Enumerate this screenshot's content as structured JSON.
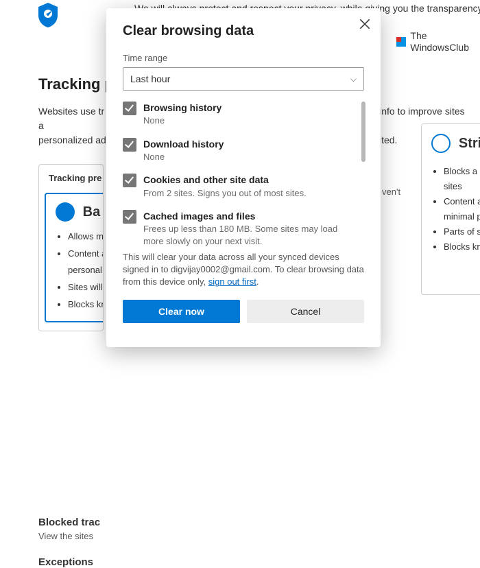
{
  "bg": {
    "top_text": "We will always protect and respect your privacy, while giving you the transparency",
    "brand_line1": "The",
    "brand_line2": "WindowsClub",
    "heading": "Tracking p",
    "para_line1": "Websites use tr",
    "para_line2": "personalized ad",
    "para_right1": "s info to improve sites a",
    "para_right2": "isited.",
    "card_pref_title": "Tracking pre",
    "card_balanced": "Ba",
    "b_items": [
      "Allows m",
      "Content a\npersonal",
      "Sites will",
      "Blocks kn"
    ],
    "right_badge": "ven't",
    "strict_title": "Stri",
    "strict_items": [
      "Blocks a m\nsites",
      "Content an\nminimal pe",
      "Parts of sit",
      "Blocks kno"
    ],
    "blocked_title": "Blocked trac",
    "blocked_sub": "View the sites",
    "exceptions_title": "Exceptions"
  },
  "modal": {
    "title": "Clear browsing data",
    "time_range_label": "Time range",
    "time_range_value": "Last hour",
    "opts": [
      {
        "title": "Browsing history",
        "sub": "None"
      },
      {
        "title": "Download history",
        "sub": "None"
      },
      {
        "title": "Cookies and other site data",
        "sub": "From 2 sites. Signs you out of most sites."
      },
      {
        "title": "Cached images and files",
        "sub": "Frees up less than 180 MB. Some sites may load more slowly on your next visit."
      }
    ],
    "sync_pre": "This will clear your data across all your synced devices signed in to digvijay0002@gmail.com. To clear browsing data from this device only, ",
    "sync_link": "sign out first",
    "sync_post": ".",
    "clear_btn": "Clear now",
    "cancel_btn": "Cancel"
  }
}
